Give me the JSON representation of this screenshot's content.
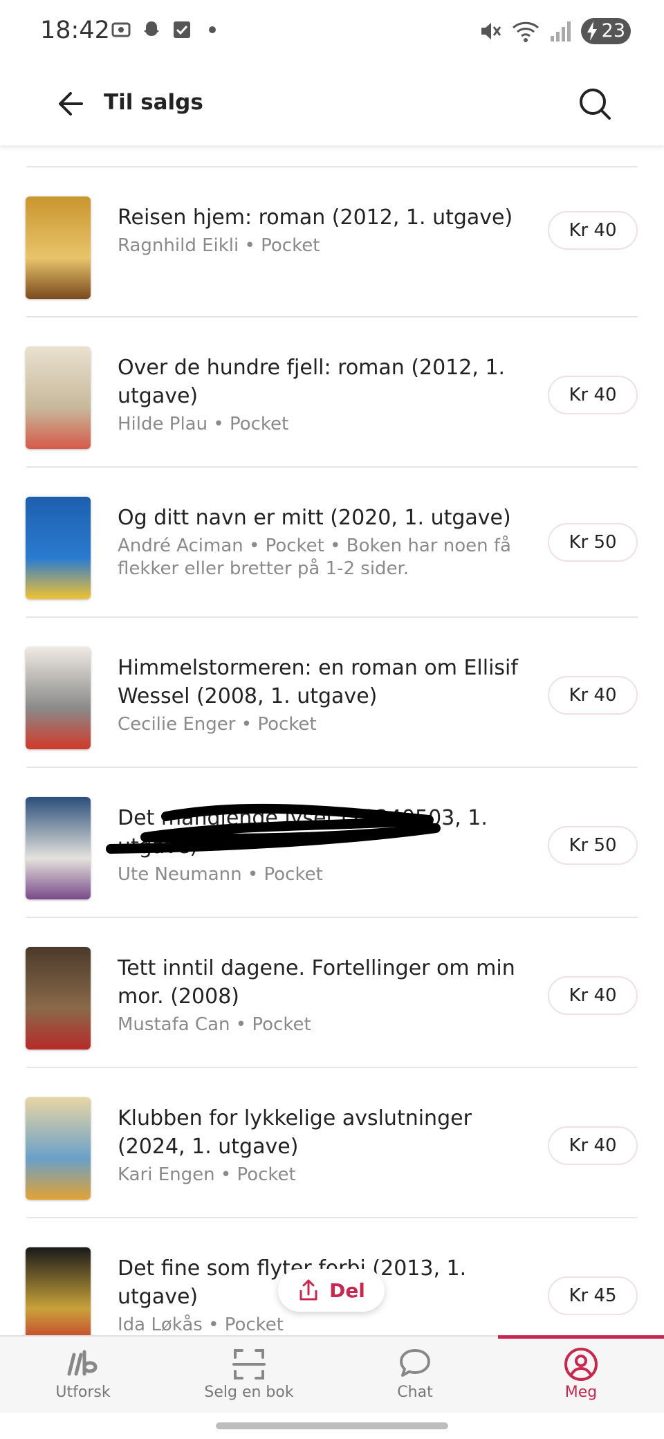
{
  "status_bar": {
    "time": "18:42",
    "battery": "23"
  },
  "app_bar": {
    "title": "Til salgs"
  },
  "listings": [
    {
      "title": "Reisen hjem: roman (2012, 1. utgave)",
      "meta": "Ragnhild Eikli • Pocket",
      "price": "Kr 40",
      "cover_colors": [
        "#c9952f",
        "#e8c46a",
        "#7a4a1e"
      ]
    },
    {
      "title": "Over de hundre fjell: roman (2012, 1. utgave)",
      "meta": "Hilde Plau • Pocket",
      "price": "Kr 40",
      "cover_colors": [
        "#e9e1cf",
        "#c7b89a",
        "#d55a4a"
      ]
    },
    {
      "title": "Og ditt navn er mitt (2020, 1. utgave)",
      "meta": "André Aciman • Pocket • Boken har noen få flekker eller bretter på 1-2 sider.",
      "price": "Kr 50",
      "cover_colors": [
        "#1d5fae",
        "#2a7bd0",
        "#f2c230"
      ]
    },
    {
      "title": "Himmelstormeren: en roman om Ellisif Wessel (2008, 1. utgave)",
      "meta": "Cecilie Enger • Pocket",
      "price": "Kr 40",
      "cover_colors": [
        "#efeae2",
        "#8a8a8a",
        "#d23a2a"
      ]
    },
    {
      "title": "Det manglende lyset (20240503, 1. utgave)",
      "meta": "Ute Neumann • Pocket",
      "price": "Kr 50",
      "cover_colors": [
        "#2b4f7a",
        "#e4e2dc",
        "#7a4a8a"
      ]
    },
    {
      "title": "Tett inntil dagene. Fortellinger om min mor.  (2008)",
      "meta": "Mustafa Can • Pocket",
      "price": "Kr 40",
      "cover_colors": [
        "#4b3a2a",
        "#8a6a4a",
        "#b72a2a"
      ]
    },
    {
      "title": "Klubben for lykkelige avslutninger (2024, 1. utgave)",
      "meta": "Kari Engen • Pocket",
      "price": "Kr 40",
      "cover_colors": [
        "#e9d6a4",
        "#6aa0c8",
        "#e2a233"
      ]
    },
    {
      "title": "Det fine som flyter forbi (2013, 1. utgave)",
      "meta": "Ida Løkås • Pocket",
      "price": "Kr 45",
      "cover_colors": [
        "#1a1a1a",
        "#c8a23a",
        "#c8282a"
      ]
    }
  ],
  "share_button": {
    "label": "Del"
  },
  "bottom_nav": {
    "items": [
      {
        "label": "Utforsk",
        "icon": "utforsk-icon"
      },
      {
        "label": "Selg en bok",
        "icon": "scan-icon"
      },
      {
        "label": "Chat",
        "icon": "chat-icon"
      },
      {
        "label": "Meg",
        "icon": "profile-icon"
      }
    ]
  },
  "colors": {
    "accent": "#c8284f",
    "meta_text": "#8a8a8a",
    "divider": "#e6e6e6"
  }
}
